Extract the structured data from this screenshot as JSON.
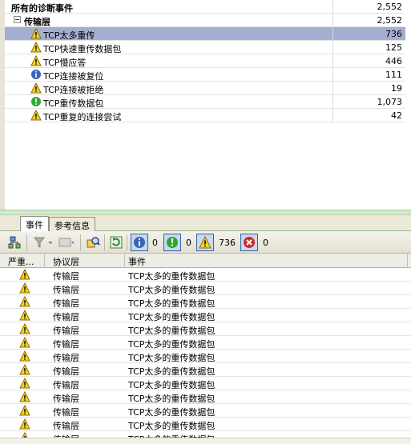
{
  "tree": {
    "rows": [
      {
        "label": "所有的诊断事件",
        "count": "2,552",
        "level": 0,
        "bold": true,
        "icon": "",
        "selected": false
      },
      {
        "label": "传输层",
        "count": "2,552",
        "level": 1,
        "bold": true,
        "icon": "collapse-icon",
        "selected": false
      },
      {
        "label": "TCP太多重传",
        "count": "736",
        "level": 2,
        "bold": false,
        "icon": "warning-icon",
        "selected": true
      },
      {
        "label": "TCP快速重传数据包",
        "count": "125",
        "level": 2,
        "bold": false,
        "icon": "warning-icon",
        "selected": false
      },
      {
        "label": "TCP慢应答",
        "count": "446",
        "level": 2,
        "bold": false,
        "icon": "warning-icon",
        "selected": false
      },
      {
        "label": "TCP连接被复位",
        "count": "111",
        "level": 2,
        "bold": false,
        "icon": "info-icon",
        "selected": false
      },
      {
        "label": "TCP连接被拒绝",
        "count": "19",
        "level": 2,
        "bold": false,
        "icon": "warning-icon",
        "selected": false
      },
      {
        "label": "TCP重传数据包",
        "count": "1,073",
        "level": 2,
        "bold": false,
        "icon": "ok-icon",
        "selected": false
      },
      {
        "label": "TCP重复的连接尝试",
        "count": "42",
        "level": 2,
        "bold": false,
        "icon": "warning-icon",
        "selected": false
      }
    ]
  },
  "tabs": [
    {
      "label": "事件",
      "active": true
    },
    {
      "label": "参考信息",
      "active": false
    }
  ],
  "toolbar": {
    "info_count": "0",
    "ok_count": "0",
    "warning_count": "736",
    "error_count": "0"
  },
  "grid": {
    "columns": [
      "严重...",
      "协议层",
      "事件"
    ],
    "rows": [
      {
        "severity": "warning-icon",
        "layer": "传输层",
        "event": "TCP太多的重传数据包"
      },
      {
        "severity": "warning-icon",
        "layer": "传输层",
        "event": "TCP太多的重传数据包"
      },
      {
        "severity": "warning-icon",
        "layer": "传输层",
        "event": "TCP太多的重传数据包"
      },
      {
        "severity": "warning-icon",
        "layer": "传输层",
        "event": "TCP太多的重传数据包"
      },
      {
        "severity": "warning-icon",
        "layer": "传输层",
        "event": "TCP太多的重传数据包"
      },
      {
        "severity": "warning-icon",
        "layer": "传输层",
        "event": "TCP太多的重传数据包"
      },
      {
        "severity": "warning-icon",
        "layer": "传输层",
        "event": "TCP太多的重传数据包"
      },
      {
        "severity": "warning-icon",
        "layer": "传输层",
        "event": "TCP太多的重传数据包"
      },
      {
        "severity": "warning-icon",
        "layer": "传输层",
        "event": "TCP太多的重传数据包"
      },
      {
        "severity": "warning-icon",
        "layer": "传输层",
        "event": "TCP太多的重传数据包"
      },
      {
        "severity": "warning-icon",
        "layer": "传输层",
        "event": "TCP太多的重传数据包"
      },
      {
        "severity": "warning-icon",
        "layer": "传输层",
        "event": "TCP太多的重传数据包"
      },
      {
        "severity": "warning-icon",
        "layer": "传输层",
        "event": "TCP太多的重传数据包"
      }
    ]
  },
  "colors": {
    "selected_row": "#a4aed2",
    "warning": "#f6d323",
    "ok": "#2fa82f",
    "error": "#d62828",
    "info": "#3c64b4"
  }
}
